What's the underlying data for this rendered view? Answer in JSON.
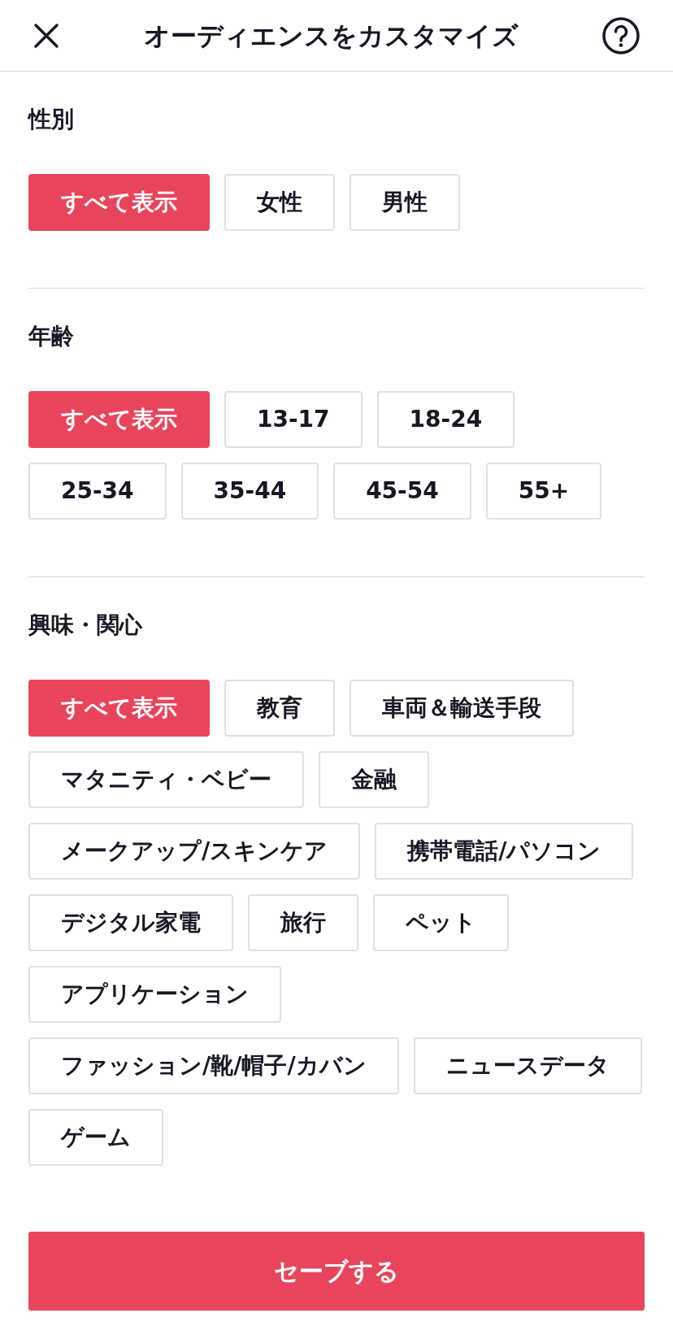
{
  "header": {
    "title": "オーディエンスをカスタマイズ"
  },
  "sections": [
    {
      "title": "性別",
      "options": [
        {
          "label": "すべて表示",
          "selected": true
        },
        {
          "label": "女性",
          "selected": false
        },
        {
          "label": "男性",
          "selected": false
        }
      ]
    },
    {
      "title": "年齢",
      "options": [
        {
          "label": "すべて表示",
          "selected": true
        },
        {
          "label": "13-17",
          "selected": false
        },
        {
          "label": "18-24",
          "selected": false
        },
        {
          "label": "25-34",
          "selected": false
        },
        {
          "label": "35-44",
          "selected": false
        },
        {
          "label": "45-54",
          "selected": false
        },
        {
          "label": "55+",
          "selected": false
        }
      ]
    },
    {
      "title": "興味・関心",
      "options": [
        {
          "label": "すべて表示",
          "selected": true
        },
        {
          "label": "教育",
          "selected": false
        },
        {
          "label": "車両＆輸送手段",
          "selected": false
        },
        {
          "label": "マタニティ・ベビー",
          "selected": false
        },
        {
          "label": "金融",
          "selected": false
        },
        {
          "label": "メークアップ/スキンケア",
          "selected": false
        },
        {
          "label": "携帯電話/パソコン",
          "selected": false
        },
        {
          "label": "デジタル家電",
          "selected": false
        },
        {
          "label": "旅行",
          "selected": false
        },
        {
          "label": "ペット",
          "selected": false
        },
        {
          "label": "アプリケーション",
          "selected": false
        },
        {
          "label": "ファッション/靴/帽子/カバン",
          "selected": false
        },
        {
          "label": "ニュースデータ",
          "selected": false
        },
        {
          "label": "ゲーム",
          "selected": false
        }
      ]
    }
  ],
  "save_button": {
    "label": "セーブする"
  }
}
